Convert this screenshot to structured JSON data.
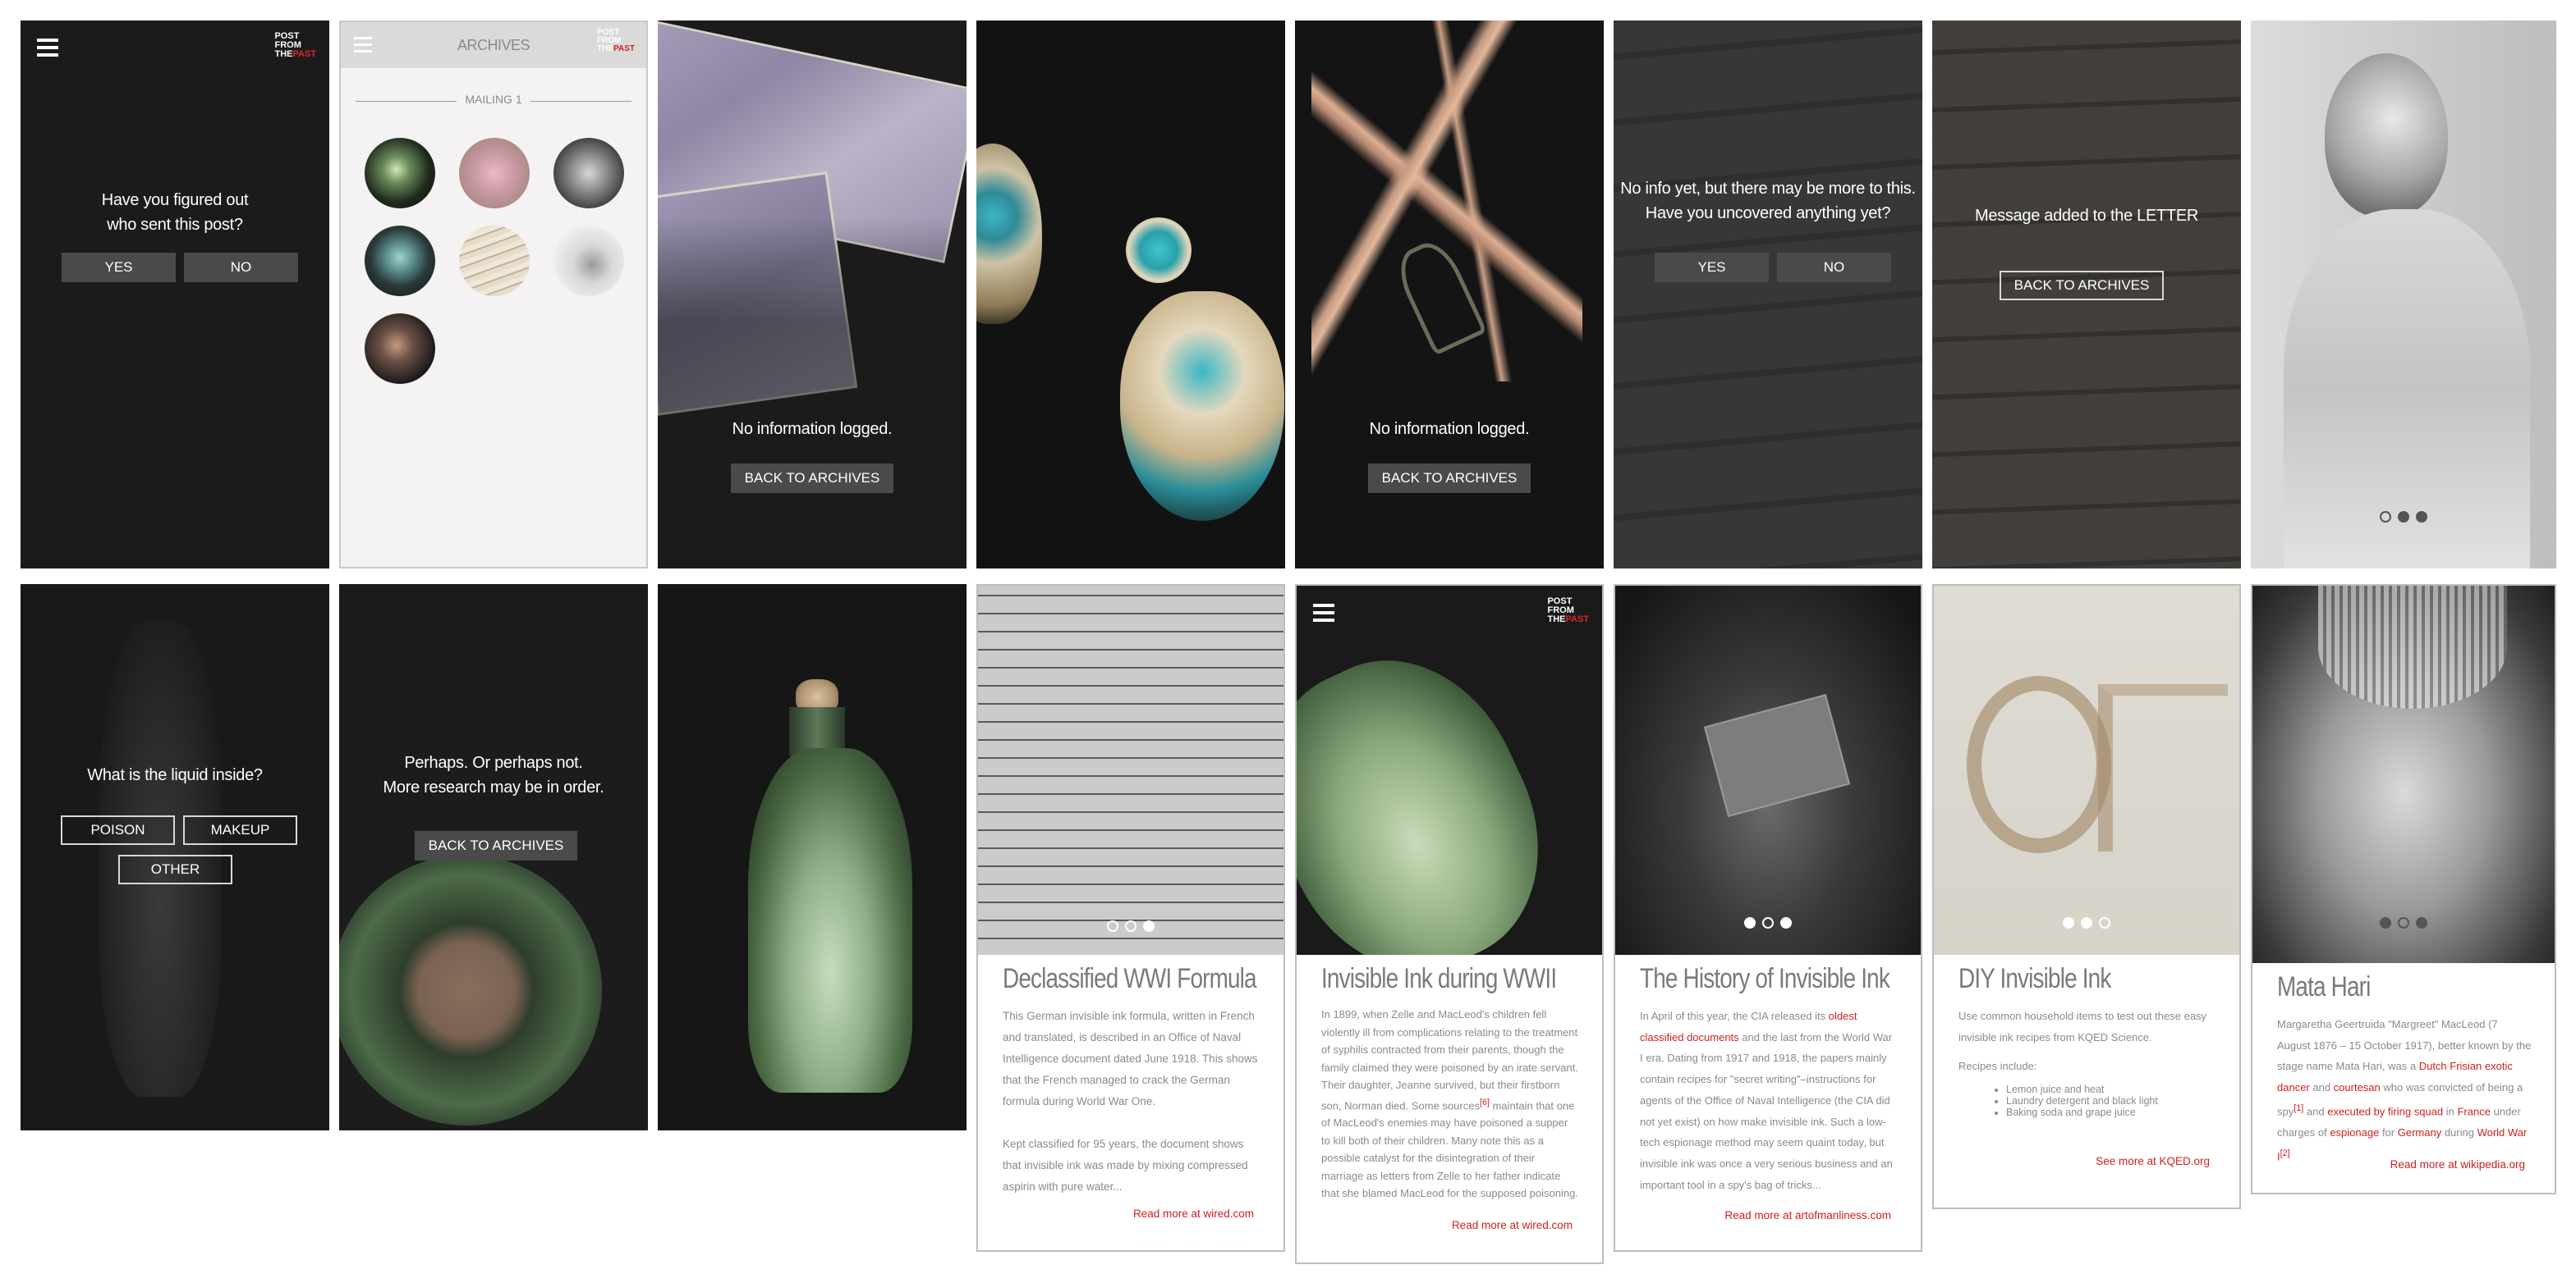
{
  "app": {
    "logo_line1": "POST",
    "logo_line2": "FROM",
    "logo_line3": "THE",
    "logo_accent": "PAST",
    "accent_color": "#e0262b"
  },
  "s1": {
    "question_line1": "Have you figured out",
    "question_line2": "who sent this post?",
    "yes": "YES",
    "no": "NO"
  },
  "s2": {
    "title": "ARCHIVES",
    "section": "MAILING 1"
  },
  "s3": {
    "status": "No information logged.",
    "back": "BACK TO ARCHIVES"
  },
  "s5": {
    "status": "No information logged.",
    "back": "BACK TO ARCHIVES"
  },
  "s6": {
    "line1": "No info yet, but there may be more to this.",
    "line2": "Have you uncovered anything yet?",
    "yes": "YES",
    "no": "NO"
  },
  "s7": {
    "message": "Message added to the LETTER",
    "back": "BACK TO ARCHIVES"
  },
  "s9": {
    "question": "What is the liquid inside?",
    "opt1": "POISON",
    "opt2": "MAKEUP",
    "opt3": "OTHER"
  },
  "s10": {
    "line1": "Perhaps. Or perhaps not.",
    "line2": "More research may be in order.",
    "back": "BACK TO ARCHIVES"
  },
  "cards": {
    "c1": {
      "title": "Declassified WWI Formula",
      "p1": "This German invisible ink formula, written in French and translated, is described in an Office of Naval Intelligence document dated June 1918. This shows that the French managed to crack the German formula during World War One.",
      "p2": "Kept classified for 95 years, the document shows that invisible ink was made by mixing compressed aspirin with pure water...",
      "more": "Read more at wired.com"
    },
    "c2": {
      "title": "Invisible Ink during WWII",
      "p1a": "In 1899, when Zelle and MacLeod's children fell violently ill from complications relating to the treatment of syphilis contracted from their parents, though the family claimed they were poisoned by an irate servant. Their daughter, Jeanne survived, but their firstborn son, Norman died. Some sources",
      "ref": "[6]",
      "p1b": " maintain that one of MacLeod's enemies may have poisoned a supper to kill both of their children. Many note this as a possible catalyst for the disintegration of their marriage as letters from Zelle to her father indicate that she blamed MacLeod for the supposed poisoning.",
      "more": "Read more at wired.com"
    },
    "c3": {
      "title": "The History of Invisible Ink",
      "p1a": "In April of this year, the CIA released its ",
      "link1": "oldest classified documents",
      "p1b": " and the last from the World War I era. Dating from 1917 and 1918, the papers mainly contain recipes for \"secret writing\"–instructions for agents of the Office of Naval Intelligence (the CIA did not yet exist) on how make invisible ink. Such a low-tech espionage method may seem quaint today, but invisible ink was once a very serious business and an important tool in a spy's bag of tricks...",
      "more": "Read more at artofmanliness.com"
    },
    "c4": {
      "title": "DIY Invisible Ink",
      "p1": "Use common household items to test out these easy invisible ink recipes from KQED Science.",
      "p2": "Recipes include:",
      "items": [
        "Lemon juice and heat",
        "Laundry detergent and black light",
        "Baking soda and grape juice"
      ],
      "more": "See more at KQED.org"
    },
    "c5": {
      "title": "Mata Hari",
      "t1": "Margaretha Geertruida \"Margreet\" MacLeod (7 August 1876 – 15 October 1917), better known by the stage name Mata Hari, was a ",
      "l1": "Dutch Frisian exotic dancer",
      "t2": " and ",
      "l2": "courtesan",
      "t3": " who was convicted of being a spy",
      "r1": "[1]",
      "t4": " and ",
      "l3": "executed by firing squad",
      "t5": " in ",
      "l4": "France",
      "t6": " under charges of ",
      "l5": "espionage",
      "t7": " for ",
      "l6": "Germany",
      "t8": " during ",
      "l7": "World War I",
      "r2": "[2]",
      "more": "Read more at wikipedia.org"
    }
  }
}
